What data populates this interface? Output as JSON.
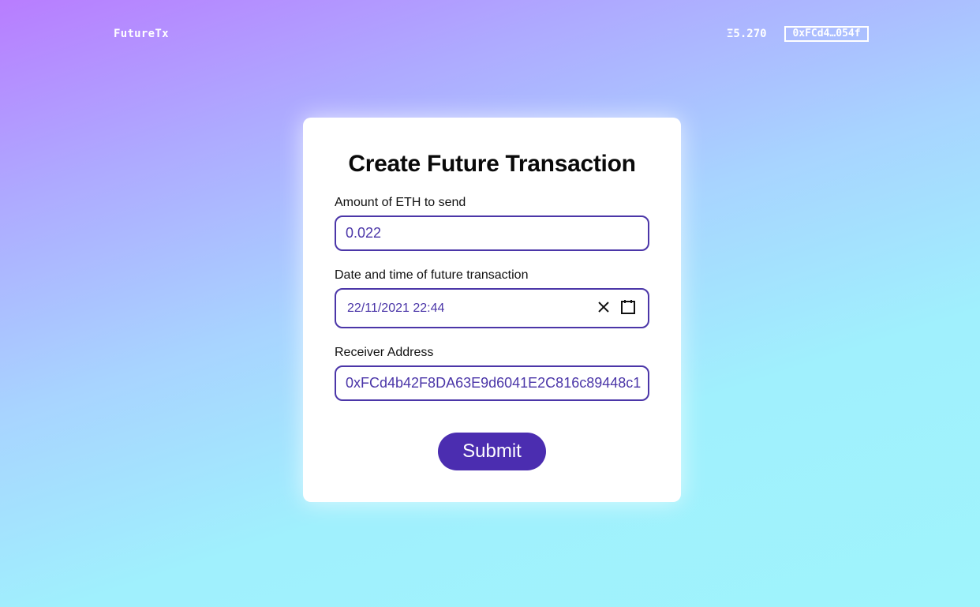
{
  "header": {
    "brand": "FutureTx",
    "balance": "Ξ5.270",
    "account": "0xFCd4…054f"
  },
  "form": {
    "title": "Create Future Transaction",
    "amount": {
      "label": "Amount of ETH to send",
      "value": "0.022"
    },
    "datetime": {
      "label": "Date and time of future transaction",
      "value": "22/11/2021 22:44",
      "clear_icon": "close-icon",
      "calendar_icon": "calendar-icon"
    },
    "receiver": {
      "label": "Receiver Address",
      "value": "0xFCd4b42F8DA63E9d6041E2C816c89448c1"
    },
    "submit_label": "Submit"
  },
  "colors": {
    "accent": "#4b2db0",
    "field_border": "#4b36a8",
    "gradient_top": "#b87dff",
    "gradient_bottom": "#9ff4fc"
  }
}
